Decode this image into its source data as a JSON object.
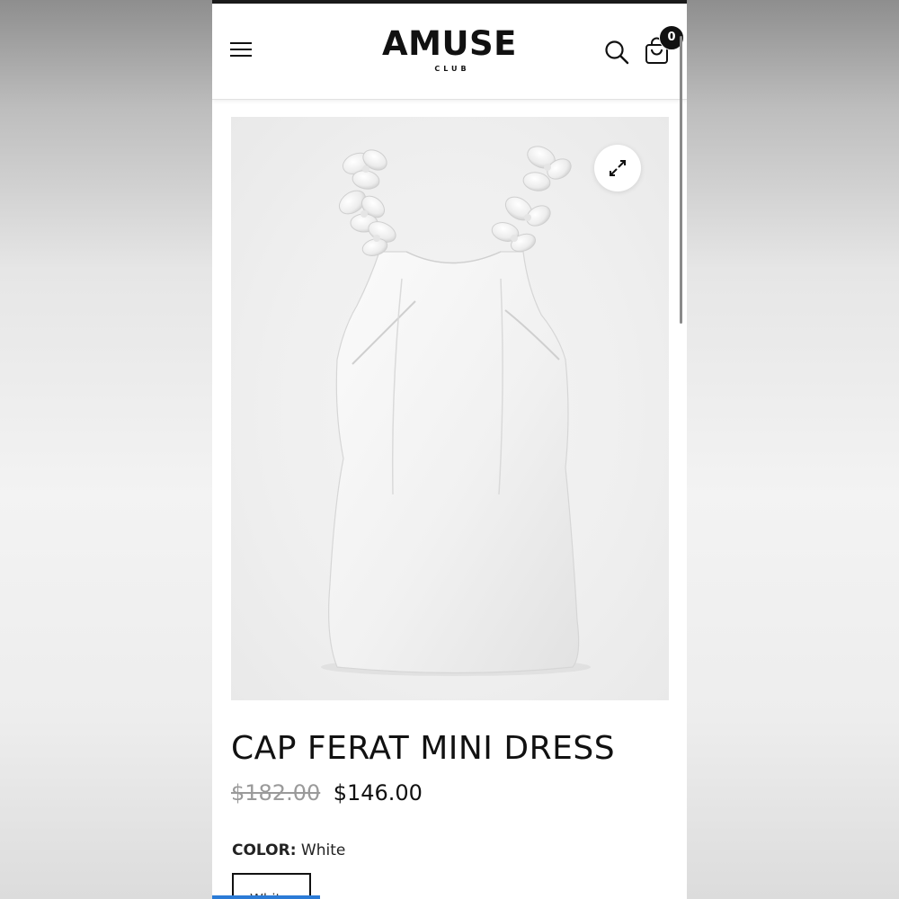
{
  "header": {
    "logo_main": "AMUSE",
    "logo_sub": "CLUB",
    "menu_icon": "hamburger-menu-icon",
    "search_icon": "search-icon",
    "cart_icon": "shopping-bag-icon",
    "cart_count": "0"
  },
  "product": {
    "image_alt": "White mini dress with 3D flower straps",
    "expand_icon": "expand-icon",
    "title": "CAP FERAT MINI DRESS",
    "compare_at_price": "$182.00",
    "price": "$146.00",
    "color_label": "COLOR:",
    "color_value": "White",
    "swatches": [
      "White"
    ]
  },
  "colors": {
    "text": "#111111",
    "muted": "#9a9a9a",
    "accent": "#2b7bd6"
  }
}
